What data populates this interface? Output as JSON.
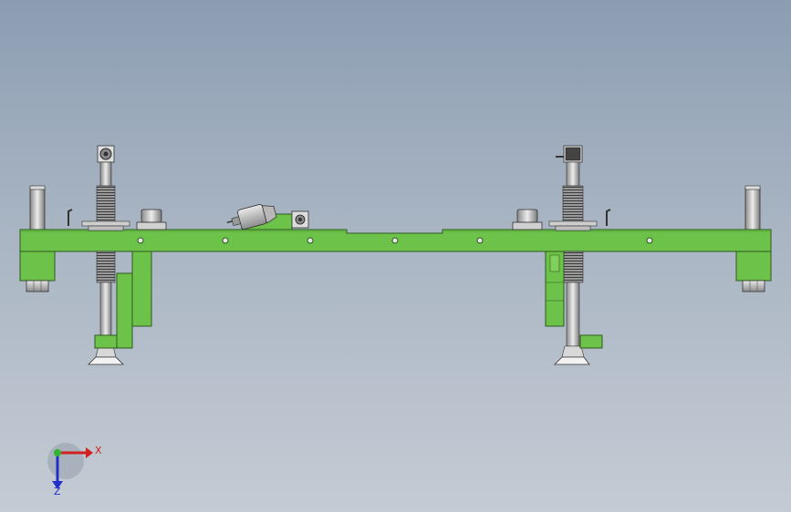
{
  "view": {
    "background_top": "#8c9db2",
    "background_bottom": "#c4cbd4",
    "part_color": "#6dc24a",
    "part_edge": "#2d5a1f",
    "metal_color": "#c9c9c9"
  },
  "triad": {
    "x_label": "X",
    "z_label": "Z",
    "x_color": "#d42020",
    "y_color": "#2fb52f",
    "z_color": "#2030c8"
  }
}
